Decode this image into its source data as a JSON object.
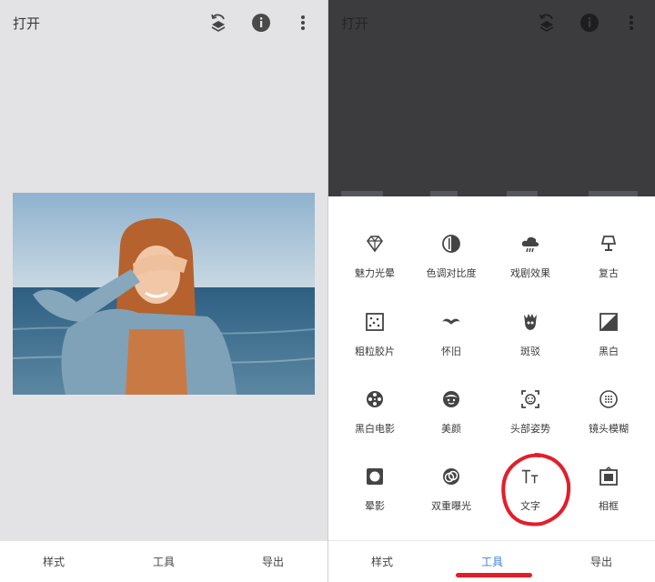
{
  "left": {
    "header": {
      "title": "打开",
      "icons": [
        "history-layers-icon",
        "info-icon",
        "more-vert-icon"
      ]
    },
    "photo": {
      "subject": "photo-of-woman-at-beach"
    },
    "nav": {
      "tabs": [
        "样式",
        "工具",
        "导出"
      ]
    }
  },
  "right": {
    "header": {
      "title": "打开",
      "icons": [
        "history-layers-icon",
        "info-icon",
        "more-vert-icon"
      ]
    },
    "tools": [
      {
        "label": "魅力光晕",
        "icon": "glamour-glow-icon"
      },
      {
        "label": "色调对比度",
        "icon": "tonal-contrast-icon"
      },
      {
        "label": "戏剧效果",
        "icon": "drama-icon"
      },
      {
        "label": "复古",
        "icon": "vintage-lamp-icon"
      },
      {
        "label": "粗粒胶片",
        "icon": "grainy-film-icon"
      },
      {
        "label": "怀旧",
        "icon": "mustache-icon"
      },
      {
        "label": "斑驳",
        "icon": "grunge-icon"
      },
      {
        "label": "黑白",
        "icon": "black-white-icon"
      },
      {
        "label": "黑白电影",
        "icon": "film-reel-icon"
      },
      {
        "label": "美颜",
        "icon": "face-icon"
      },
      {
        "label": "头部姿势",
        "icon": "head-pose-icon"
      },
      {
        "label": "镜头模糊",
        "icon": "lens-blur-icon"
      },
      {
        "label": "晕影",
        "icon": "vignette-icon"
      },
      {
        "label": "双重曝光",
        "icon": "double-exposure-icon"
      },
      {
        "label": "文字",
        "icon": "text-tt-icon"
      },
      {
        "label": "相框",
        "icon": "frame-icon"
      }
    ],
    "nav": {
      "tabs": [
        "样式",
        "工具",
        "导出"
      ],
      "active": "工具"
    }
  },
  "colors": {
    "accent": "#3f7ee8",
    "annotation_red": "#e31e2b",
    "dark_overlay": "#3c3b3d",
    "canvas_bg": "#e3e2e4"
  }
}
